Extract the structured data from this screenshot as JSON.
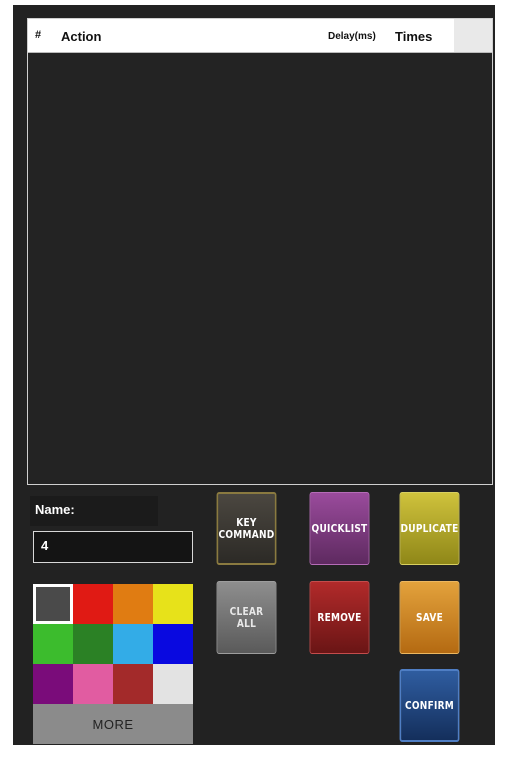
{
  "table": {
    "columns": [
      "#",
      "Action",
      "Delay(ms)",
      "Times"
    ],
    "rows": []
  },
  "name": {
    "label": "Name:",
    "value": "4"
  },
  "colors": {
    "swatches": [
      "#4a4a4a",
      "#e01a14",
      "#e07c12",
      "#e7e21a",
      "#3cbc2d",
      "#2b8125",
      "#33ace7",
      "#0909e0",
      "#7a0c7a",
      "#e15ca1",
      "#a32a2a",
      "#e3e3e3"
    ],
    "selected_index": 0,
    "more_label": "MORE"
  },
  "buttons": {
    "key_command": "KEY\nCOMMAND",
    "quicklist": "QUICKLIST",
    "duplicate": "DUPLICATE",
    "clear_all": "CLEAR\nALL",
    "remove": "REMOVE",
    "save": "SAVE",
    "confirm": "CONFIRM"
  }
}
